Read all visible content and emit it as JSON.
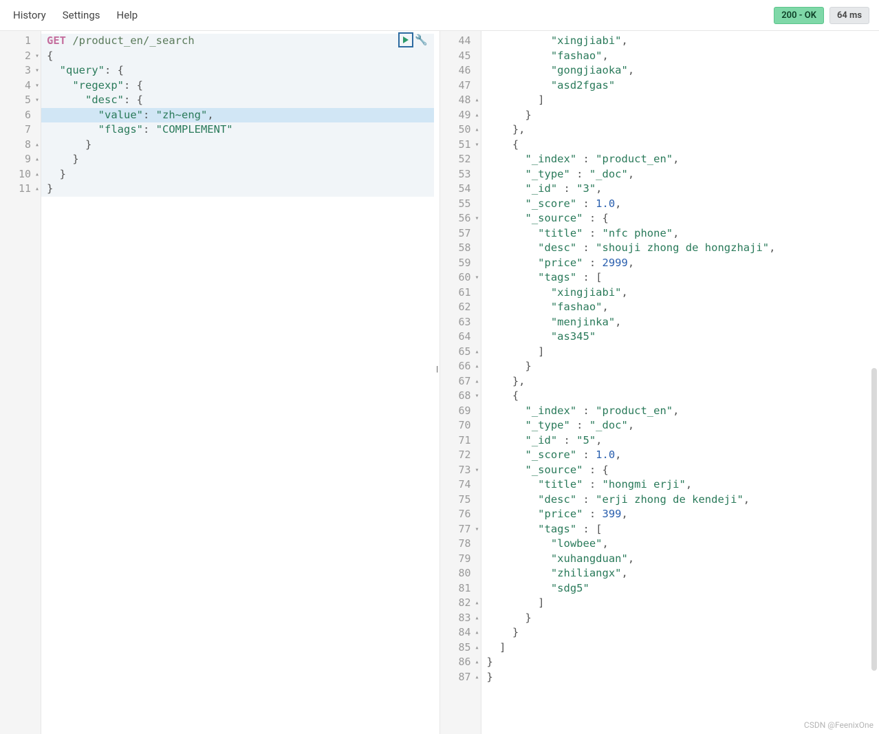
{
  "menu": {
    "history": "History",
    "settings": "Settings",
    "help": "Help"
  },
  "status": {
    "code": "200 - OK",
    "time": "64 ms"
  },
  "watermark": "CSDN @FeenixOne",
  "request": {
    "lines": [
      {
        "n": 1,
        "fold": "",
        "segs": [
          [
            "method",
            "GET"
          ],
          [
            "plain",
            " "
          ],
          [
            "path",
            "/product_en/_search"
          ]
        ]
      },
      {
        "n": 2,
        "fold": "▾",
        "segs": [
          [
            "brace",
            "{"
          ]
        ]
      },
      {
        "n": 3,
        "fold": "▾",
        "segs": [
          [
            "plain",
            "  "
          ],
          [
            "key",
            "\"query\""
          ],
          [
            "punc",
            ": "
          ],
          [
            "brace",
            "{"
          ]
        ]
      },
      {
        "n": 4,
        "fold": "▾",
        "segs": [
          [
            "plain",
            "    "
          ],
          [
            "key",
            "\"regexp\""
          ],
          [
            "punc",
            ": "
          ],
          [
            "brace",
            "{"
          ]
        ]
      },
      {
        "n": 5,
        "fold": "▾",
        "segs": [
          [
            "plain",
            "      "
          ],
          [
            "key",
            "\"desc\""
          ],
          [
            "punc",
            ": "
          ],
          [
            "brace",
            "{"
          ]
        ]
      },
      {
        "n": 6,
        "fold": "",
        "segs": [
          [
            "plain",
            "        "
          ],
          [
            "key",
            "\"value\""
          ],
          [
            "punc",
            ": "
          ],
          [
            "str",
            "\"zh~eng\""
          ],
          [
            "punc",
            ","
          ]
        ]
      },
      {
        "n": 7,
        "fold": "",
        "segs": [
          [
            "plain",
            "        "
          ],
          [
            "key",
            "\"flags\""
          ],
          [
            "punc",
            ": "
          ],
          [
            "str",
            "\"COMPLEMENT\""
          ]
        ]
      },
      {
        "n": 8,
        "fold": "▴",
        "segs": [
          [
            "plain",
            "      "
          ],
          [
            "brace",
            "}"
          ]
        ]
      },
      {
        "n": 9,
        "fold": "▴",
        "segs": [
          [
            "plain",
            "    "
          ],
          [
            "brace",
            "}"
          ]
        ]
      },
      {
        "n": 10,
        "fold": "▴",
        "segs": [
          [
            "plain",
            "  "
          ],
          [
            "brace",
            "}"
          ]
        ]
      },
      {
        "n": 11,
        "fold": "▴",
        "segs": [
          [
            "brace",
            "}"
          ]
        ]
      }
    ],
    "active_line": 6,
    "bg_lines": 11
  },
  "response": {
    "start": 44,
    "lines": [
      {
        "n": 44,
        "fold": "",
        "segs": [
          [
            "plain",
            "          "
          ],
          [
            "str",
            "\"xingjiabi\""
          ],
          [
            "punc",
            ","
          ]
        ]
      },
      {
        "n": 45,
        "fold": "",
        "segs": [
          [
            "plain",
            "          "
          ],
          [
            "str",
            "\"fashao\""
          ],
          [
            "punc",
            ","
          ]
        ]
      },
      {
        "n": 46,
        "fold": "",
        "segs": [
          [
            "plain",
            "          "
          ],
          [
            "str",
            "\"gongjiaoka\""
          ],
          [
            "punc",
            ","
          ]
        ]
      },
      {
        "n": 47,
        "fold": "",
        "segs": [
          [
            "plain",
            "          "
          ],
          [
            "str",
            "\"asd2fgas\""
          ]
        ]
      },
      {
        "n": 48,
        "fold": "▴",
        "segs": [
          [
            "plain",
            "        "
          ],
          [
            "brace",
            "]"
          ]
        ]
      },
      {
        "n": 49,
        "fold": "▴",
        "segs": [
          [
            "plain",
            "      "
          ],
          [
            "brace",
            "}"
          ]
        ]
      },
      {
        "n": 50,
        "fold": "▴",
        "segs": [
          [
            "plain",
            "    "
          ],
          [
            "brace",
            "}"
          ],
          [
            "punc",
            ","
          ]
        ]
      },
      {
        "n": 51,
        "fold": "▾",
        "segs": [
          [
            "plain",
            "    "
          ],
          [
            "brace",
            "{"
          ]
        ]
      },
      {
        "n": 52,
        "fold": "",
        "segs": [
          [
            "plain",
            "      "
          ],
          [
            "key",
            "\"_index\""
          ],
          [
            "punc",
            " : "
          ],
          [
            "str",
            "\"product_en\""
          ],
          [
            "punc",
            ","
          ]
        ]
      },
      {
        "n": 53,
        "fold": "",
        "segs": [
          [
            "plain",
            "      "
          ],
          [
            "key",
            "\"_type\""
          ],
          [
            "punc",
            " : "
          ],
          [
            "str",
            "\"_doc\""
          ],
          [
            "punc",
            ","
          ]
        ]
      },
      {
        "n": 54,
        "fold": "",
        "segs": [
          [
            "plain",
            "      "
          ],
          [
            "key",
            "\"_id\""
          ],
          [
            "punc",
            " : "
          ],
          [
            "str",
            "\"3\""
          ],
          [
            "punc",
            ","
          ]
        ]
      },
      {
        "n": 55,
        "fold": "",
        "segs": [
          [
            "plain",
            "      "
          ],
          [
            "key",
            "\"_score\""
          ],
          [
            "punc",
            " : "
          ],
          [
            "num",
            "1.0"
          ],
          [
            "punc",
            ","
          ]
        ]
      },
      {
        "n": 56,
        "fold": "▾",
        "segs": [
          [
            "plain",
            "      "
          ],
          [
            "key",
            "\"_source\""
          ],
          [
            "punc",
            " : "
          ],
          [
            "brace",
            "{"
          ]
        ]
      },
      {
        "n": 57,
        "fold": "",
        "segs": [
          [
            "plain",
            "        "
          ],
          [
            "key",
            "\"title\""
          ],
          [
            "punc",
            " : "
          ],
          [
            "str",
            "\"nfc phone\""
          ],
          [
            "punc",
            ","
          ]
        ]
      },
      {
        "n": 58,
        "fold": "",
        "segs": [
          [
            "plain",
            "        "
          ],
          [
            "key",
            "\"desc\""
          ],
          [
            "punc",
            " : "
          ],
          [
            "str",
            "\"shouji zhong de hongzhaji\""
          ],
          [
            "punc",
            ","
          ]
        ]
      },
      {
        "n": 59,
        "fold": "",
        "segs": [
          [
            "plain",
            "        "
          ],
          [
            "key",
            "\"price\""
          ],
          [
            "punc",
            " : "
          ],
          [
            "num",
            "2999"
          ],
          [
            "punc",
            ","
          ]
        ]
      },
      {
        "n": 60,
        "fold": "▾",
        "segs": [
          [
            "plain",
            "        "
          ],
          [
            "key",
            "\"tags\""
          ],
          [
            "punc",
            " : "
          ],
          [
            "brace",
            "["
          ]
        ]
      },
      {
        "n": 61,
        "fold": "",
        "segs": [
          [
            "plain",
            "          "
          ],
          [
            "str",
            "\"xingjiabi\""
          ],
          [
            "punc",
            ","
          ]
        ]
      },
      {
        "n": 62,
        "fold": "",
        "segs": [
          [
            "plain",
            "          "
          ],
          [
            "str",
            "\"fashao\""
          ],
          [
            "punc",
            ","
          ]
        ]
      },
      {
        "n": 63,
        "fold": "",
        "segs": [
          [
            "plain",
            "          "
          ],
          [
            "str",
            "\"menjinka\""
          ],
          [
            "punc",
            ","
          ]
        ]
      },
      {
        "n": 64,
        "fold": "",
        "segs": [
          [
            "plain",
            "          "
          ],
          [
            "str",
            "\"as345\""
          ]
        ]
      },
      {
        "n": 65,
        "fold": "▴",
        "segs": [
          [
            "plain",
            "        "
          ],
          [
            "brace",
            "]"
          ]
        ]
      },
      {
        "n": 66,
        "fold": "▴",
        "segs": [
          [
            "plain",
            "      "
          ],
          [
            "brace",
            "}"
          ]
        ]
      },
      {
        "n": 67,
        "fold": "▴",
        "segs": [
          [
            "plain",
            "    "
          ],
          [
            "brace",
            "}"
          ],
          [
            "punc",
            ","
          ]
        ]
      },
      {
        "n": 68,
        "fold": "▾",
        "segs": [
          [
            "plain",
            "    "
          ],
          [
            "brace",
            "{"
          ]
        ]
      },
      {
        "n": 69,
        "fold": "",
        "segs": [
          [
            "plain",
            "      "
          ],
          [
            "key",
            "\"_index\""
          ],
          [
            "punc",
            " : "
          ],
          [
            "str",
            "\"product_en\""
          ],
          [
            "punc",
            ","
          ]
        ]
      },
      {
        "n": 70,
        "fold": "",
        "segs": [
          [
            "plain",
            "      "
          ],
          [
            "key",
            "\"_type\""
          ],
          [
            "punc",
            " : "
          ],
          [
            "str",
            "\"_doc\""
          ],
          [
            "punc",
            ","
          ]
        ]
      },
      {
        "n": 71,
        "fold": "",
        "segs": [
          [
            "plain",
            "      "
          ],
          [
            "key",
            "\"_id\""
          ],
          [
            "punc",
            " : "
          ],
          [
            "str",
            "\"5\""
          ],
          [
            "punc",
            ","
          ]
        ]
      },
      {
        "n": 72,
        "fold": "",
        "segs": [
          [
            "plain",
            "      "
          ],
          [
            "key",
            "\"_score\""
          ],
          [
            "punc",
            " : "
          ],
          [
            "num",
            "1.0"
          ],
          [
            "punc",
            ","
          ]
        ]
      },
      {
        "n": 73,
        "fold": "▾",
        "segs": [
          [
            "plain",
            "      "
          ],
          [
            "key",
            "\"_source\""
          ],
          [
            "punc",
            " : "
          ],
          [
            "brace",
            "{"
          ]
        ]
      },
      {
        "n": 74,
        "fold": "",
        "segs": [
          [
            "plain",
            "        "
          ],
          [
            "key",
            "\"title\""
          ],
          [
            "punc",
            " : "
          ],
          [
            "str",
            "\"hongmi erji\""
          ],
          [
            "punc",
            ","
          ]
        ]
      },
      {
        "n": 75,
        "fold": "",
        "segs": [
          [
            "plain",
            "        "
          ],
          [
            "key",
            "\"desc\""
          ],
          [
            "punc",
            " : "
          ],
          [
            "str",
            "\"erji zhong de kendeji\""
          ],
          [
            "punc",
            ","
          ]
        ]
      },
      {
        "n": 76,
        "fold": "",
        "segs": [
          [
            "plain",
            "        "
          ],
          [
            "key",
            "\"price\""
          ],
          [
            "punc",
            " : "
          ],
          [
            "num",
            "399"
          ],
          [
            "punc",
            ","
          ]
        ]
      },
      {
        "n": 77,
        "fold": "▾",
        "segs": [
          [
            "plain",
            "        "
          ],
          [
            "key",
            "\"tags\""
          ],
          [
            "punc",
            " : "
          ],
          [
            "brace",
            "["
          ]
        ]
      },
      {
        "n": 78,
        "fold": "",
        "segs": [
          [
            "plain",
            "          "
          ],
          [
            "str",
            "\"lowbee\""
          ],
          [
            "punc",
            ","
          ]
        ]
      },
      {
        "n": 79,
        "fold": "",
        "segs": [
          [
            "plain",
            "          "
          ],
          [
            "str",
            "\"xuhangduan\""
          ],
          [
            "punc",
            ","
          ]
        ]
      },
      {
        "n": 80,
        "fold": "",
        "segs": [
          [
            "plain",
            "          "
          ],
          [
            "str",
            "\"zhiliangx\""
          ],
          [
            "punc",
            ","
          ]
        ]
      },
      {
        "n": 81,
        "fold": "",
        "segs": [
          [
            "plain",
            "          "
          ],
          [
            "str",
            "\"sdg5\""
          ]
        ]
      },
      {
        "n": 82,
        "fold": "▴",
        "segs": [
          [
            "plain",
            "        "
          ],
          [
            "brace",
            "]"
          ]
        ]
      },
      {
        "n": 83,
        "fold": "▴",
        "segs": [
          [
            "plain",
            "      "
          ],
          [
            "brace",
            "}"
          ]
        ]
      },
      {
        "n": 84,
        "fold": "▴",
        "segs": [
          [
            "plain",
            "    "
          ],
          [
            "brace",
            "}"
          ]
        ]
      },
      {
        "n": 85,
        "fold": "▴",
        "segs": [
          [
            "plain",
            "  "
          ],
          [
            "brace",
            "]"
          ]
        ]
      },
      {
        "n": 86,
        "fold": "▴",
        "segs": [
          [
            "brace",
            "}"
          ]
        ]
      },
      {
        "n": 87,
        "fold": "▴",
        "segs": [
          [
            "brace",
            "}"
          ]
        ]
      }
    ]
  }
}
